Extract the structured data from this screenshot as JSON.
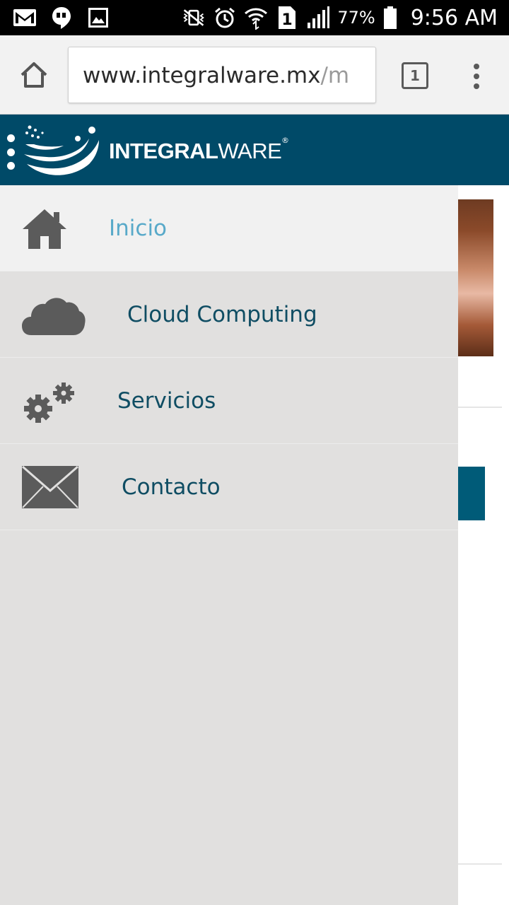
{
  "status_bar": {
    "battery_percent": "77%",
    "time": "9:56 AM",
    "sim_slot": "1",
    "icons_left": [
      "gmail-icon",
      "hangouts-icon",
      "gallery-icon"
    ],
    "icons_right": [
      "mute-vibrate-icon",
      "alarm-icon",
      "wifi-icon",
      "sim-icon",
      "signal-icon",
      "battery-icon"
    ]
  },
  "browser": {
    "url_host": "www.integralware.mx",
    "url_path": "/m",
    "tab_count": "1"
  },
  "site_header": {
    "logo_bold": "INTEGRAL",
    "logo_light": "WARE",
    "logo_registered": "®",
    "background_color": "#004a68"
  },
  "drawer": {
    "items": [
      {
        "label": "Inicio",
        "icon": "home-icon",
        "active": true
      },
      {
        "label": "Cloud Computing",
        "icon": "cloud-icon",
        "active": false
      },
      {
        "label": "Servicios",
        "icon": "gears-icon",
        "active": false
      },
      {
        "label": "Contacto",
        "icon": "envelope-icon",
        "active": false
      }
    ],
    "active_color": "#58a9c9",
    "text_color": "#0f4d63"
  }
}
